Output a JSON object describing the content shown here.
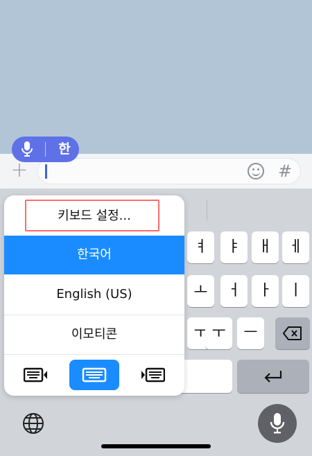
{
  "input": {
    "plus_icon": "plus-icon",
    "emoji_icon": "emoji-icon",
    "hash_symbol": "#"
  },
  "voice_pill": {
    "mic_icon": "microphone-icon",
    "language": "한"
  },
  "keyboard": {
    "row1": [
      "ㅕ",
      "ㅑ",
      "ㅐ",
      "ㅔ"
    ],
    "row2": [
      "ㅗ",
      "ㅓ",
      "ㅏ",
      "ㅣ"
    ],
    "row3": [
      "ㅜ",
      "ㅜ",
      "ㅡ"
    ],
    "backspace_icon": "backspace-icon",
    "return_icon": "return-icon",
    "globe_icon": "globe-icon",
    "dictation_icon": "microphone-icon"
  },
  "language_menu": {
    "keyboard_settings": "키보드 설정...",
    "items": [
      "한국어",
      "English (US)",
      "이모티콘"
    ],
    "selected": "한국어",
    "modes": [
      "left-handed-keyboard-icon",
      "full-keyboard-icon",
      "right-handed-keyboard-icon"
    ],
    "active_mode": "full-keyboard-icon",
    "colors": {
      "selected": "#1a8cff",
      "highlight_outline": "#ff6b6b"
    }
  }
}
